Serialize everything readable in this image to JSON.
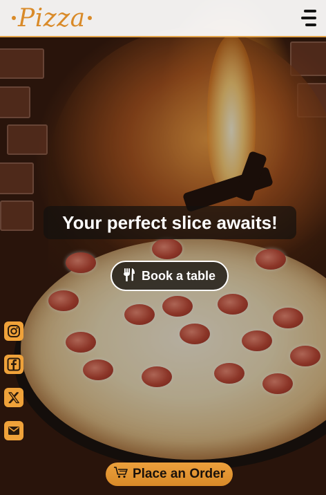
{
  "header": {
    "logo_text": "Pizza",
    "menu_icon": "hamburger-menu-icon"
  },
  "hero": {
    "tagline": "Your perfect slice awaits!",
    "book_button": {
      "label": "Book a table",
      "icon": "fork-knife-icon"
    }
  },
  "social": {
    "items": [
      {
        "name": "instagram",
        "icon": "instagram-icon"
      },
      {
        "name": "facebook",
        "icon": "facebook-icon"
      },
      {
        "name": "x",
        "icon": "x-icon"
      },
      {
        "name": "email",
        "icon": "mail-icon"
      }
    ]
  },
  "order_button": {
    "label": "Place an Order",
    "icon": "cart-icon"
  },
  "colors": {
    "accent": "#d98a28",
    "header_bg": "#ffffff",
    "text_light": "#ffffff",
    "text_dark": "#141414"
  }
}
